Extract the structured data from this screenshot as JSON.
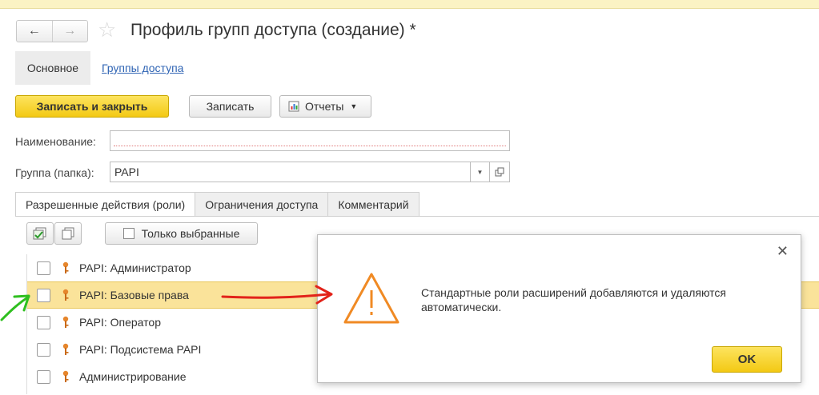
{
  "window": {
    "title": "Профиль групп доступа (создание) *"
  },
  "nav": {
    "back_icon": "arrow-left-icon",
    "forward_icon": "arrow-right-icon",
    "favorite_icon": "star-icon"
  },
  "page_tabs": [
    {
      "label": "Основное",
      "active": true
    },
    {
      "label": "Группы доступа",
      "active": false
    }
  ],
  "toolbar": {
    "save_close_label": "Записать и закрыть",
    "save_label": "Записать",
    "reports_label": "Отчеты"
  },
  "form": {
    "name_label": "Наименование:",
    "name_value": "",
    "group_label": "Группа (папка):",
    "group_value": "PAPI"
  },
  "tabs": [
    {
      "label": "Разрешенные действия (роли)",
      "active": true
    },
    {
      "label": "Ограничения доступа",
      "active": false
    },
    {
      "label": "Комментарий",
      "active": false
    }
  ],
  "roles_toolbar": {
    "only_selected_label": "Только выбранные"
  },
  "roles": [
    {
      "label": "PAPI: Администратор",
      "checked": false,
      "selected": false
    },
    {
      "label": "PAPI: Базовые права",
      "checked": false,
      "selected": true
    },
    {
      "label": "PAPI: Оператор",
      "checked": false,
      "selected": false
    },
    {
      "label": "PAPI: Подсистема PAPI",
      "checked": false,
      "selected": false
    },
    {
      "label": "Администрирование",
      "checked": false,
      "selected": false
    }
  ],
  "dialog": {
    "message": "Стандартные роли расширений добавляются и удаляются автоматически.",
    "ok_label": "OK",
    "icon": "warning-icon"
  },
  "colors": {
    "primary_button": "#f3c914",
    "selected_row": "#fae39a",
    "link": "#2f64b4",
    "annotation_red": "#e2231a",
    "annotation_green": "#2fbf1f",
    "warning_orange": "#f08a24"
  }
}
